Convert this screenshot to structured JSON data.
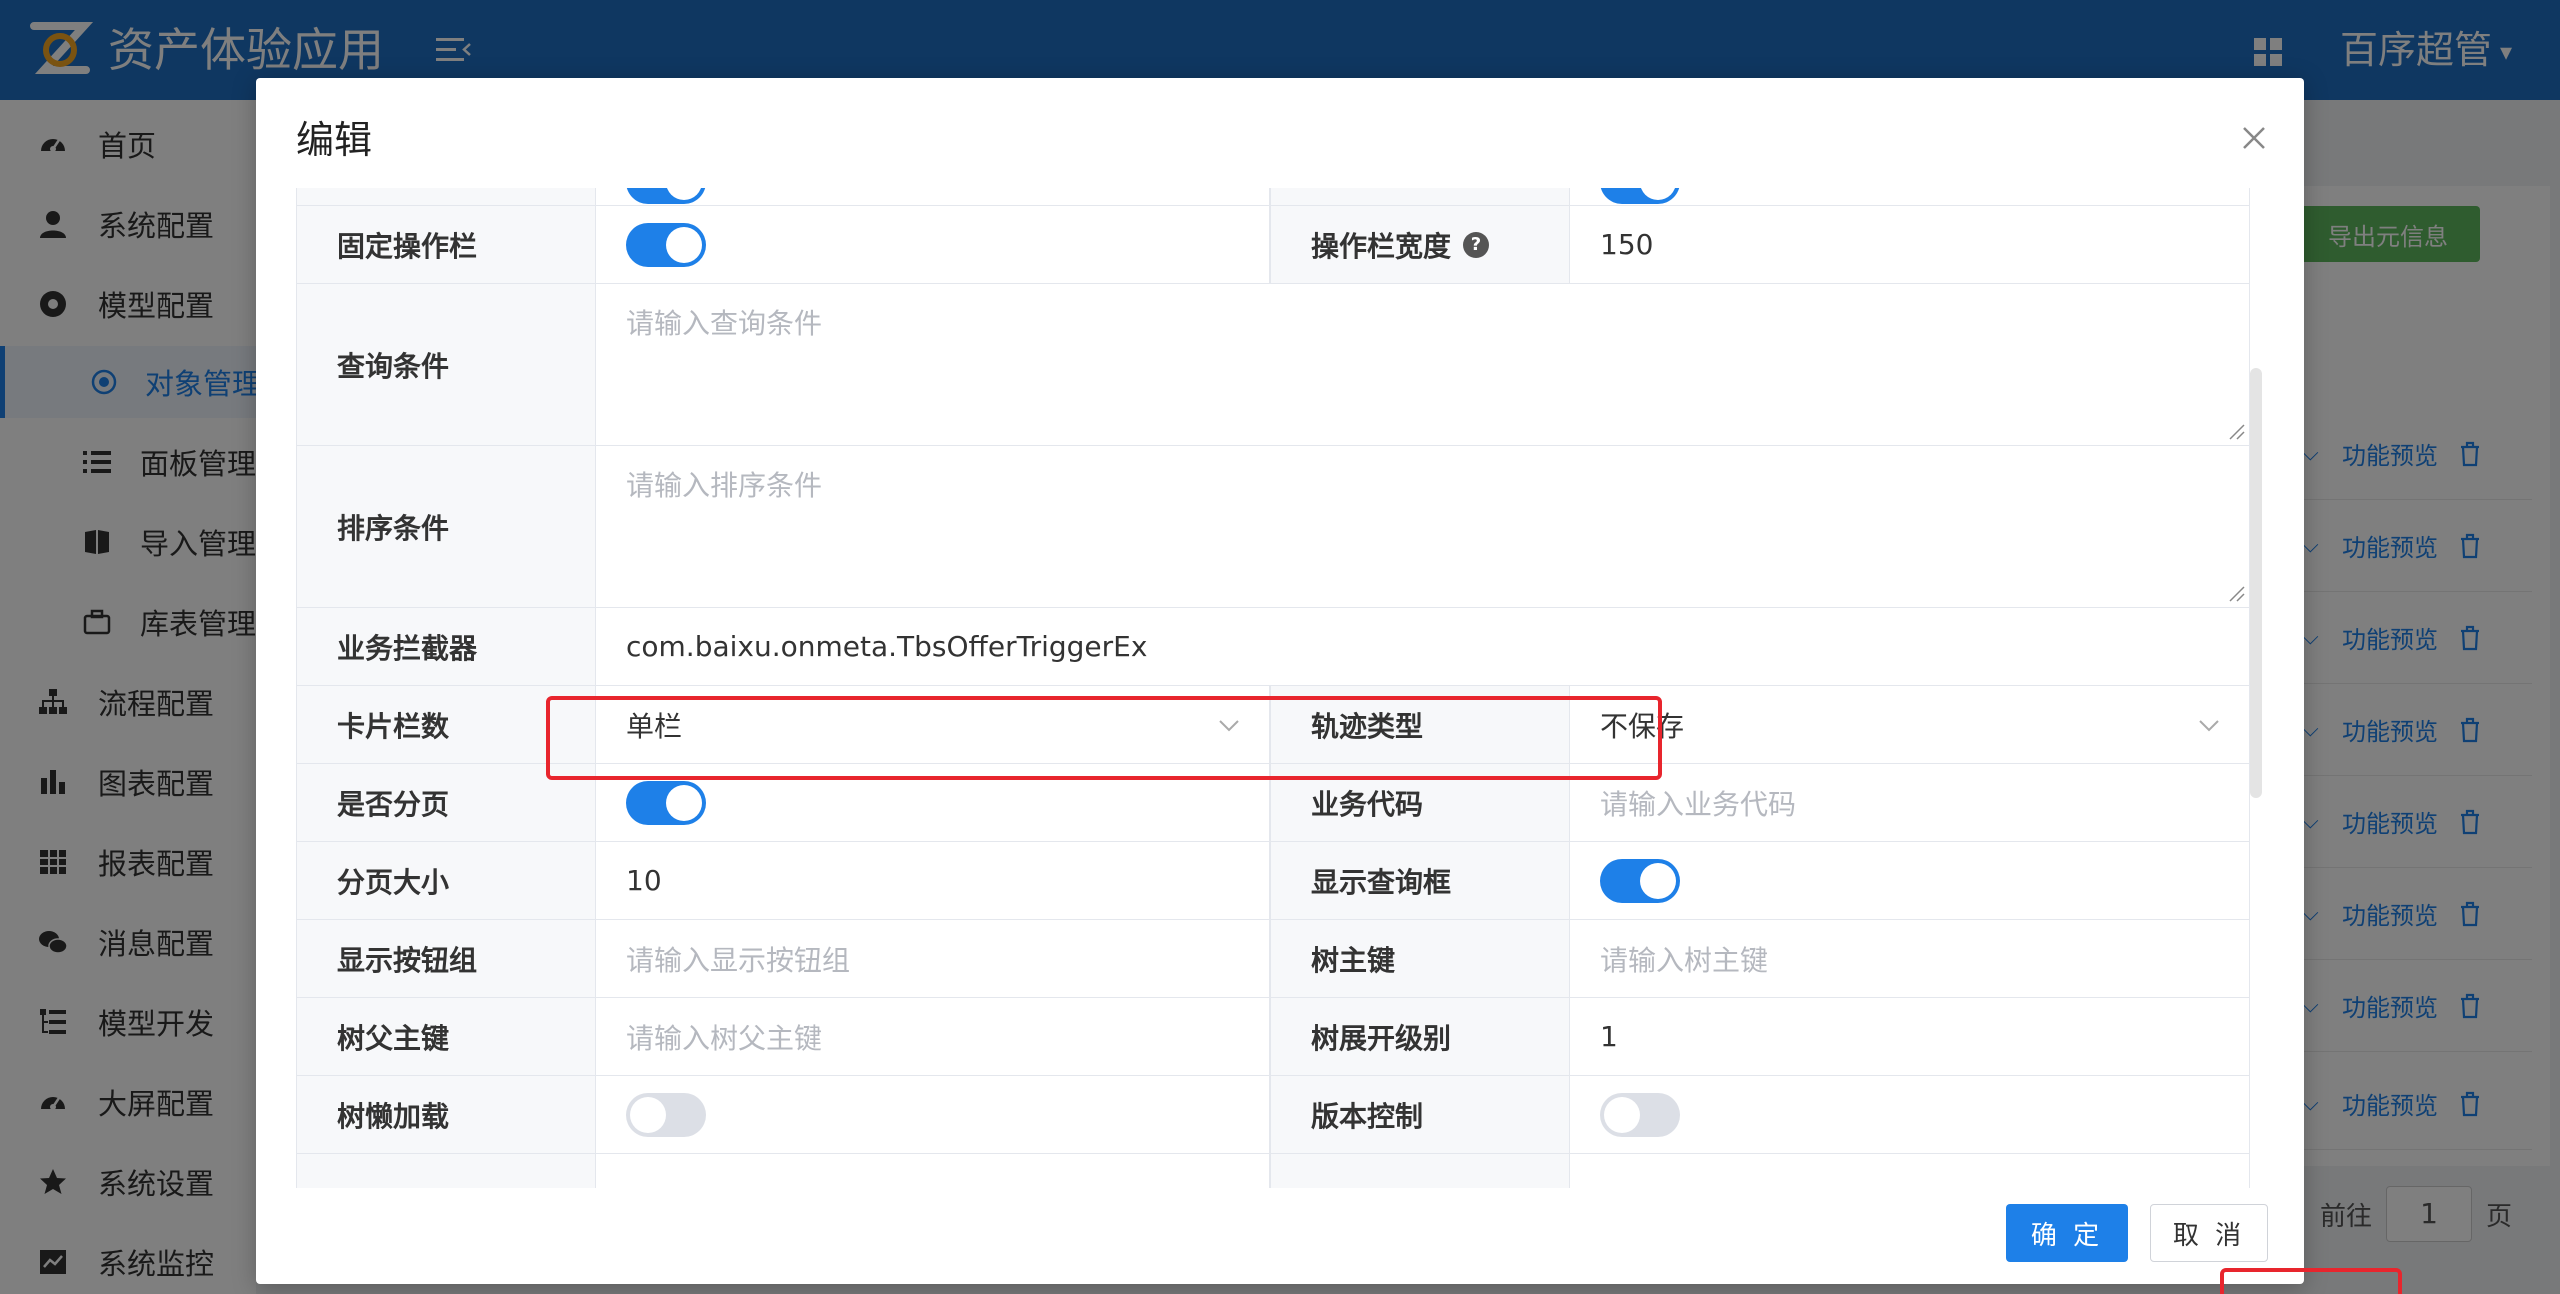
{
  "header": {
    "app_title": "资产体验应用",
    "user_name": "百序超管"
  },
  "sidebar": {
    "items": [
      {
        "label": "首页",
        "icon": "dashboard-icon"
      },
      {
        "label": "系统配置",
        "icon": "user-icon"
      },
      {
        "label": "模型配置",
        "icon": "model-icon"
      },
      {
        "label": "对象管理",
        "icon": "radio-icon",
        "active": true
      },
      {
        "label": "面板管理",
        "icon": "list-icon"
      },
      {
        "label": "导入管理",
        "icon": "book-icon"
      },
      {
        "label": "库表管理",
        "icon": "briefcase-icon"
      },
      {
        "label": "流程配置",
        "icon": "sitemap-icon"
      },
      {
        "label": "图表配置",
        "icon": "bar-chart-icon"
      },
      {
        "label": "报表配置",
        "icon": "table-icon"
      },
      {
        "label": "消息配置",
        "icon": "wechat-icon"
      },
      {
        "label": "模型开发",
        "icon": "tree-list-icon"
      },
      {
        "label": "大屏配置",
        "icon": "gauge-icon"
      },
      {
        "label": "系统设置",
        "icon": "star-icon"
      },
      {
        "label": "系统监控",
        "icon": "monitor-icon"
      }
    ]
  },
  "background": {
    "export_label": "导出元信息",
    "row_action": "功能预览",
    "pager_prefix": "前往",
    "pager_page": "1",
    "pager_suffix": "页"
  },
  "modal": {
    "title": "编辑",
    "rows": {
      "fixed_bar": {
        "label": "固定操作栏",
        "on": true
      },
      "bar_width": {
        "label": "操作栏宽度",
        "value": "150"
      },
      "query": {
        "label": "查询条件",
        "placeholder": "请输入查询条件"
      },
      "sort": {
        "label": "排序条件",
        "placeholder": "请输入排序条件"
      },
      "interceptor": {
        "label": "业务拦截器",
        "value": "com.baixu.onmeta.TbsOfferTriggerEx"
      },
      "card_cols": {
        "label": "卡片栏数",
        "value": "单栏"
      },
      "track_type": {
        "label": "轨迹类型",
        "value": "不保存"
      },
      "paging": {
        "label": "是否分页",
        "on": true
      },
      "biz_code": {
        "label": "业务代码",
        "placeholder": "请输入业务代码"
      },
      "page_size": {
        "label": "分页大小",
        "value": "10"
      },
      "show_query": {
        "label": "显示查询框",
        "on": true
      },
      "btn_group": {
        "label": "显示按钮组",
        "placeholder": "请输入显示按钮组"
      },
      "tree_key": {
        "label": "树主键",
        "placeholder": "请输入树主键"
      },
      "tree_parent": {
        "label": "树父主键",
        "placeholder": "请输入树父主键"
      },
      "tree_level": {
        "label": "树展开级别",
        "value": "1"
      },
      "tree_lazy": {
        "label": "树懒加载",
        "on": false
      },
      "version_ctrl": {
        "label": "版本控制",
        "on": false
      }
    },
    "ok_label": "确 定",
    "cancel_label": "取 消"
  },
  "colors": {
    "primary": "#1e80e8",
    "header": "#1e6fc2",
    "highlight": "#e8252d"
  }
}
